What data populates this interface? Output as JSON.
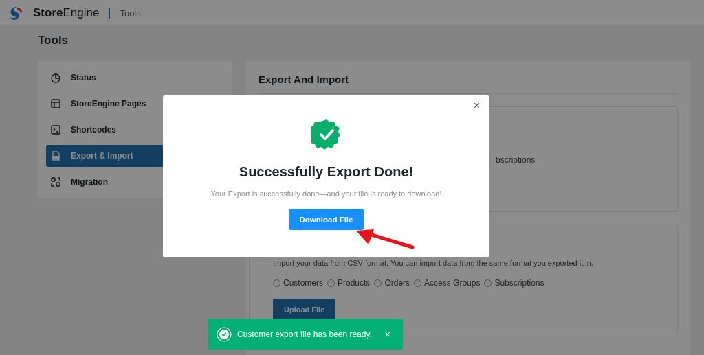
{
  "header": {
    "brand": "**Store**Engine",
    "breadcrumb": "Tools"
  },
  "page_title": "Tools",
  "sidebar": {
    "items": [
      {
        "label": "Status",
        "selected": false
      },
      {
        "label": "StoreEngine Pages",
        "selected": false
      },
      {
        "label": "Shortcodes",
        "selected": false
      },
      {
        "label": "Export & Import",
        "selected": true
      },
      {
        "label": "Migration",
        "selected": false
      }
    ]
  },
  "content": {
    "title": "Export And Import",
    "export_card": {
      "visible_text": "bscriptions"
    },
    "import_card": {
      "description": "Import your data from CSV format. You can import data from the same format you exported it in.",
      "options": [
        {
          "label": "Customers",
          "selected": false
        },
        {
          "label": "Products",
          "selected": false
        },
        {
          "label": "Orders",
          "selected": false
        },
        {
          "label": "Access Groups",
          "selected": false
        },
        {
          "label": "Subscriptions",
          "selected": false
        }
      ],
      "button": "Upload File"
    }
  },
  "modal": {
    "close": "×",
    "title": "Successfully Export Done!",
    "message": "Your Export is successfully done—and your file is ready to download!",
    "button": "Download File"
  },
  "toast": {
    "message": "Customer export file has been ready.",
    "close": "×"
  }
}
